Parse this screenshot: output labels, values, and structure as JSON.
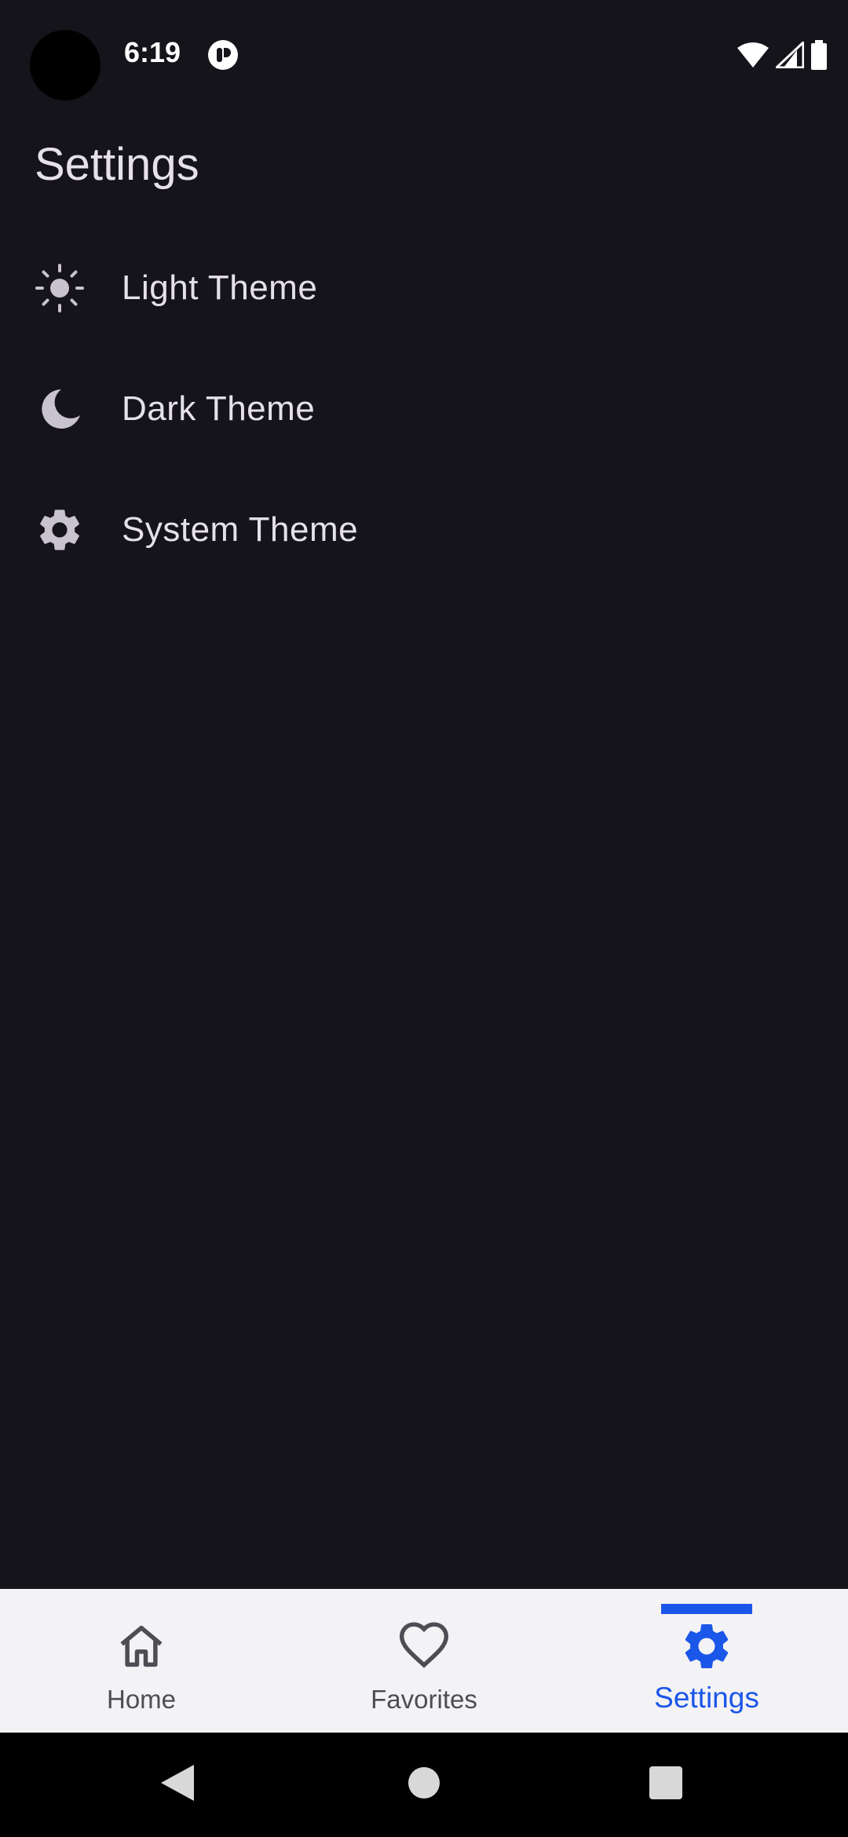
{
  "status_bar": {
    "time": "6:19",
    "icons": [
      "notification-icon",
      "wifi-icon",
      "cellular-signal-icon",
      "battery-icon"
    ]
  },
  "page": {
    "title": "Settings"
  },
  "theme_options": [
    {
      "label": "Light Theme",
      "icon": "sun-icon"
    },
    {
      "label": "Dark Theme",
      "icon": "moon-icon"
    },
    {
      "label": "System Theme",
      "icon": "gear-icon"
    }
  ],
  "bottom_nav": {
    "items": [
      {
        "label": "Home",
        "icon": "home-icon",
        "active": false
      },
      {
        "label": "Favorites",
        "icon": "heart-icon",
        "active": false
      },
      {
        "label": "Settings",
        "icon": "gear-icon",
        "active": true
      }
    ]
  },
  "system_nav": {
    "buttons": [
      "back-icon",
      "home-circle-icon",
      "recents-icon"
    ]
  },
  "colors": {
    "background": "#16141b",
    "text": "#e6e1e8",
    "icon": "#c9c3d0",
    "nav_background": "#f3f2f5",
    "nav_inactive": "#4f4c54",
    "accent": "#1a56e8",
    "system_bar": "#000000"
  }
}
